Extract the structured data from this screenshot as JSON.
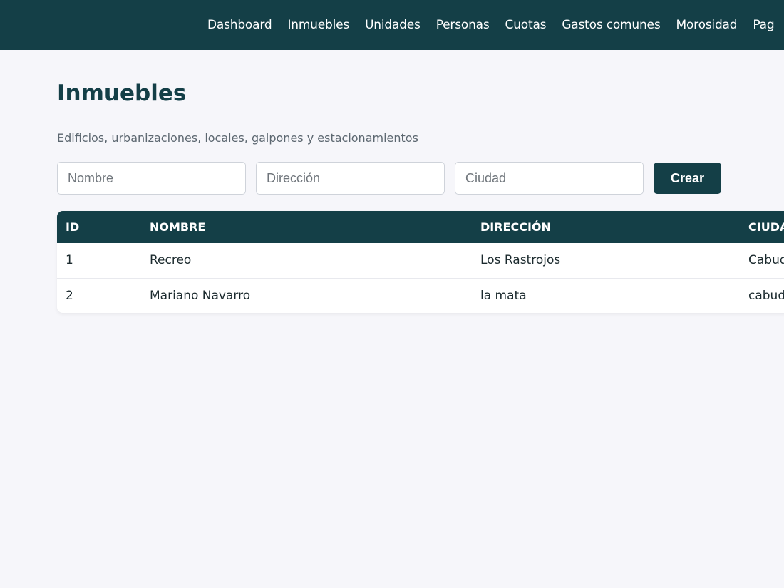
{
  "nav": {
    "items": [
      {
        "label": "Dashboard"
      },
      {
        "label": "Inmuebles"
      },
      {
        "label": "Unidades"
      },
      {
        "label": "Personas"
      },
      {
        "label": "Cuotas"
      },
      {
        "label": "Gastos comunes"
      },
      {
        "label": "Morosidad"
      },
      {
        "label": "Pag"
      }
    ]
  },
  "page": {
    "title": "Inmuebles",
    "subtitle": "Edificios, urbanizaciones, locales, galpones y estacionamientos"
  },
  "form": {
    "nombre_placeholder": "Nombre",
    "nombre_value": "",
    "direccion_placeholder": "Dirección",
    "direccion_value": "",
    "ciudad_placeholder": "Ciudad",
    "ciudad_value": "",
    "submit_label": "Crear"
  },
  "table": {
    "columns": [
      "ID",
      "NOMBRE",
      "DIRECCIÓN",
      "CIUDA"
    ],
    "rows": [
      {
        "id": "1",
        "nombre": "Recreo",
        "direccion": "Los Rastrojos",
        "ciudad": "Cabud"
      },
      {
        "id": "2",
        "nombre": "Mariano Navarro",
        "direccion": "la mata",
        "ciudad": "cabud"
      }
    ]
  },
  "colors": {
    "primary": "#143f47",
    "background": "#f6f6fa"
  }
}
